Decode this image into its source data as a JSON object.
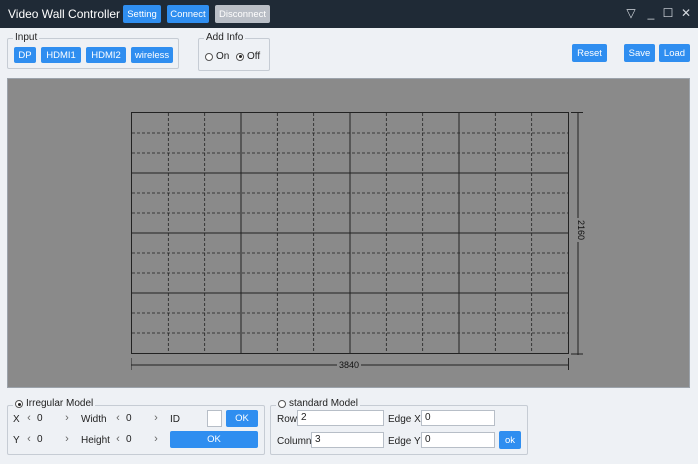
{
  "window": {
    "title": "Video Wall Controller",
    "buttons": {
      "setting": "Setting",
      "connect": "Connect",
      "disconnect": "Disconnect"
    },
    "controls": {
      "menu": "▽",
      "minimize": "_",
      "maximize": "☐",
      "close": "✕"
    }
  },
  "input_group": {
    "legend": "Input",
    "sources": [
      "DP",
      "HDMI1",
      "HDMI2",
      "wireless"
    ]
  },
  "add_info": {
    "legend": "Add Info",
    "on_label": "On",
    "off_label": "Off",
    "selected": "Off"
  },
  "actions": {
    "reset": "Reset",
    "save": "Save",
    "load": "Load"
  },
  "wall": {
    "width_label": "3840",
    "height_label": "2160",
    "columns": 4,
    "rows": 4,
    "sub_columns": 3,
    "sub_rows": 3
  },
  "irregular": {
    "legend": "Irregular Model",
    "selected": true,
    "x_label": "X",
    "x_value": "0",
    "y_label": "Y",
    "y_value": "0",
    "width_label": "Width",
    "width_value": "0",
    "height_label": "Height",
    "height_value": "0",
    "id_label": "ID",
    "ok1": "OK",
    "ok2": "OK"
  },
  "standard": {
    "legend": "standard Model",
    "selected": false,
    "row_label": "Row",
    "row_value": "2",
    "column_label": "Column",
    "column_value": "3",
    "edge_x_label": "Edge X",
    "edge_x_value": "0",
    "edge_y_label": "Edge Y",
    "edge_y_value": "0",
    "ok": "ok"
  },
  "colors": {
    "accent": "#2f8ef0",
    "titlebar": "#1f2a36",
    "canvas": "#8a8a8a"
  }
}
